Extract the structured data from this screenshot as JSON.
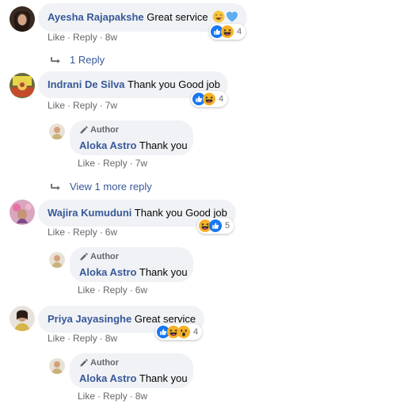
{
  "comments": [
    {
      "name": "Ayesha Rajapakshe",
      "text": "Great service",
      "like": "Like",
      "reply": "Reply",
      "time": "8w",
      "reactions": [
        "like",
        "haha"
      ],
      "reaction_count": "4",
      "text_emojis": [
        "smile",
        "blue-heart"
      ],
      "replies_link": "1 Reply"
    },
    {
      "name": "Indrani De Silva",
      "text": "Thank you Good job",
      "like": "Like",
      "reply": "Reply",
      "time": "7w",
      "reactions": [
        "like",
        "haha"
      ],
      "reaction_count": "4",
      "author_reply": {
        "badge": "Author",
        "name": "Aloka Astro",
        "text": "Thank you",
        "like": "Like",
        "reply": "Reply",
        "time": "7w"
      },
      "more_replies_link": "View 1 more reply"
    },
    {
      "name": "Wajira Kumuduni",
      "text": "Thank you Good job",
      "like": "Like",
      "reply": "Reply",
      "time": "6w",
      "reactions": [
        "haha",
        "like"
      ],
      "reaction_count": "5",
      "author_reply": {
        "badge": "Author",
        "name": "Aloka Astro",
        "text": "Thank you",
        "like": "Like",
        "reply": "Reply",
        "time": "6w"
      }
    },
    {
      "name": "Priya Jayasinghe",
      "text": "Great service",
      "like": "Like",
      "reply": "Reply",
      "time": "8w",
      "reactions": [
        "like",
        "haha",
        "wow"
      ],
      "reaction_count": "4",
      "author_reply": {
        "badge": "Author",
        "name": "Aloka Astro",
        "text": "Thank you",
        "like": "Like",
        "reply": "Reply",
        "time": "8w"
      }
    }
  ],
  "colors": {
    "name": "#385898",
    "meta": "#65676b",
    "bubble": "#f0f2f5",
    "like": "#1877f2",
    "haha": "#f7b125"
  },
  "icons": [
    "pencil-icon",
    "reply-arrow-icon",
    "like-reaction-icon",
    "haha-reaction-icon",
    "wow-reaction-icon",
    "smile-emoji-icon",
    "blue-heart-emoji-icon"
  ]
}
